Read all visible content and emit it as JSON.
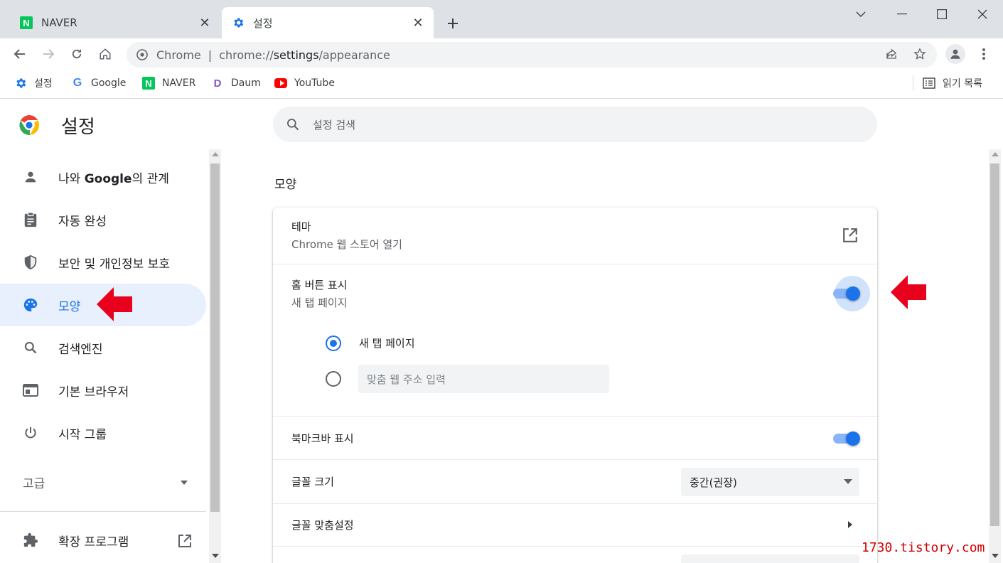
{
  "browser": {
    "tabs": [
      {
        "label": "NAVER",
        "active": false
      },
      {
        "label": "설정",
        "active": true
      }
    ],
    "omnibox": {
      "site_name": "Chrome",
      "separator": "|",
      "url_prefix": "chrome://",
      "url_host": "settings",
      "url_path": "/appearance"
    },
    "bookmarks": [
      {
        "label": "설정"
      },
      {
        "label": "Google"
      },
      {
        "label": "NAVER"
      },
      {
        "label": "Daum"
      },
      {
        "label": "YouTube"
      }
    ],
    "reading_list": "읽기 목록",
    "favicon_letters": {
      "naver": "N",
      "google": "G",
      "daum": "D"
    }
  },
  "settings": {
    "title": "설정",
    "search_placeholder": "설정 검색",
    "nav": [
      {
        "label_pre": "나와 ",
        "label_bold": "Google",
        "label_post": "의 관계",
        "icon": "person-icon"
      },
      {
        "label": "자동 완성",
        "icon": "clipboard-icon"
      },
      {
        "label": "보안 및 개인정보 보호",
        "icon": "shield-icon"
      },
      {
        "label": "모양",
        "icon": "palette-icon",
        "selected": true
      },
      {
        "label": "검색엔진",
        "icon": "search-icon"
      },
      {
        "label": "기본 브라우저",
        "icon": "browser-window-icon"
      },
      {
        "label": "시작 그룹",
        "icon": "power-icon"
      }
    ],
    "advanced": "고급",
    "extensions": "확장 프로그램",
    "section_title": "모양",
    "theme": {
      "title": "테마",
      "subtitle": "Chrome 웹 스토어 열기"
    },
    "home_button": {
      "title": "홈 버튼 표시",
      "subtitle": "새 탭 페이지",
      "enabled": true,
      "option_new_tab": "새 탭 페이지",
      "option_custom_placeholder": "맞춤 웹 주소 입력",
      "selected_option": "new_tab"
    },
    "bookmarks_bar": {
      "title": "북마크바 표시",
      "enabled": true
    },
    "font_size": {
      "title": "글꼴 크기",
      "value": "중간(권장)"
    },
    "customize_fonts": {
      "title": "글꼴 맞춤설정"
    }
  },
  "annotation": {
    "color": "#e8001c"
  },
  "watermark": "1730.tistory.com"
}
